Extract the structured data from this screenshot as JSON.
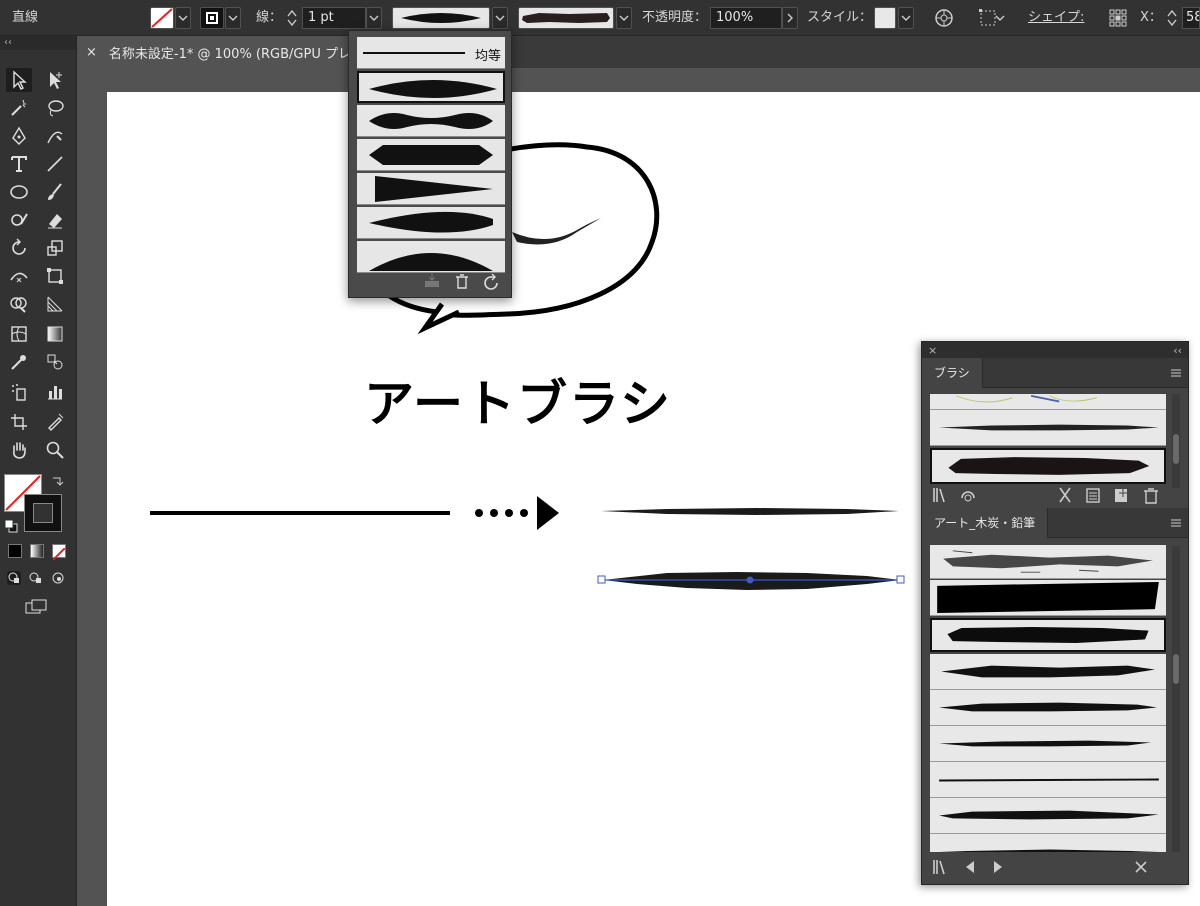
{
  "control_bar": {
    "object_type": "直線",
    "stroke_label": "線：",
    "stroke_weight": "1 pt",
    "opacity_label": "不透明度：",
    "opacity_value": "100%",
    "style_label": "スタイル：",
    "shape_label": "シェイプ:",
    "x_label": "X：",
    "x_value": "58"
  },
  "document_tab": {
    "close_glyph": "×",
    "title": "名称未設定-1* @ 100% (RGB/GPU プレビュー)"
  },
  "tools_panel": {
    "collapse_glyph": "‹‹"
  },
  "profile_popup": {
    "uniform_label": "均等"
  },
  "artboard": {
    "heading": "アートブラシ"
  },
  "brush_panel": {
    "collapse_glyph": "‹‹",
    "close_glyph": "×",
    "tab_brush": "ブラシ",
    "tab_library": "アート_木炭・鉛筆"
  },
  "colors": {
    "ui_dark": "#323232",
    "canvas_bg": "#535353",
    "artboard": "#ffffff",
    "selection_blue": "#3f5bc4",
    "none_red": "#e2231a"
  }
}
